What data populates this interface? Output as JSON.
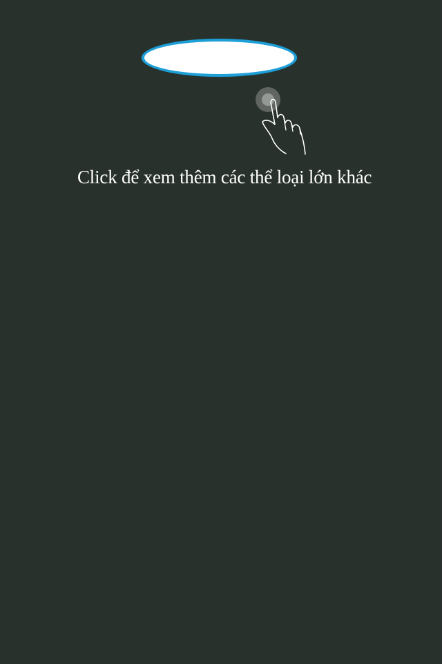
{
  "tutorial": {
    "hint_text": "Click để xem thêm các thể loại lớn khác",
    "pointer_icon": "tap-hand-icon"
  },
  "colors": {
    "background": "#28312b",
    "highlight_fill": "#ffffff",
    "highlight_border": "#1e9fd8",
    "text": "#ffffff"
  }
}
